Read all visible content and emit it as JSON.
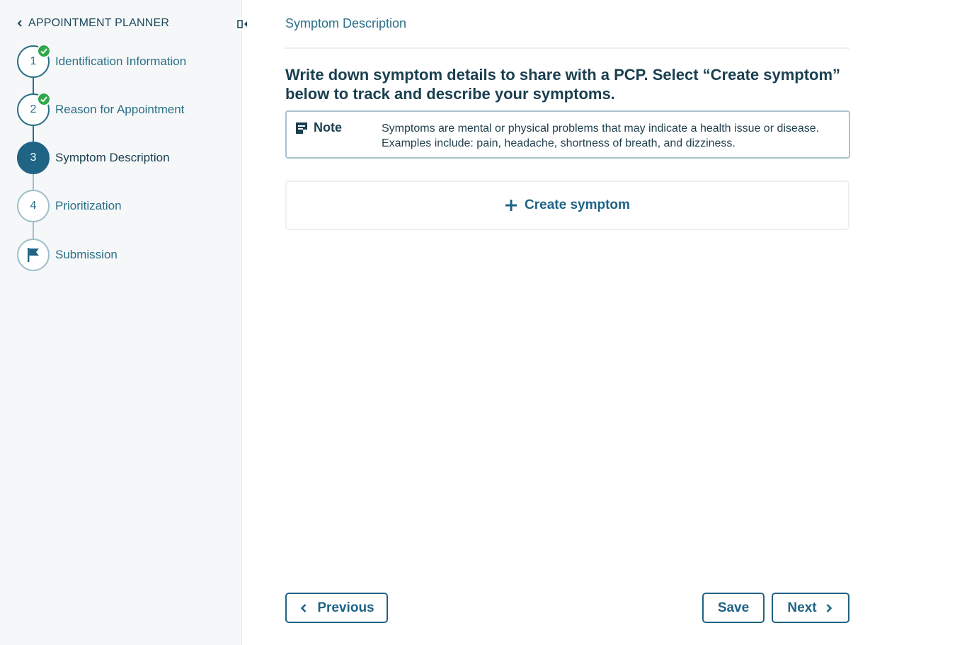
{
  "sidebar": {
    "title": "APPOINTMENT PLANNER",
    "steps": [
      {
        "number": "1",
        "label": "Identification Information",
        "status": "complete"
      },
      {
        "number": "2",
        "label": "Reason for Appointment",
        "status": "complete"
      },
      {
        "number": "3",
        "label": "Symptom Description",
        "status": "current"
      },
      {
        "number": "4",
        "label": "Prioritization",
        "status": "pending"
      },
      {
        "number": "",
        "label": "Submission",
        "status": "pending",
        "icon": "flag-icon"
      }
    ]
  },
  "main": {
    "page_title": "Symptom Description",
    "heading": "Write down symptom details to share with a PCP. Select “Create symptom” below to track and describe your symptoms.",
    "note": {
      "title": "Note",
      "body": "Symptoms are mental or physical problems that may indicate a health issue or disease. Examples include: pain, headache, shortness of breath, and dizziness."
    },
    "create_button": "Create symptom"
  },
  "footer": {
    "previous": "Previous",
    "save": "Save",
    "next": "Next"
  },
  "colors": {
    "accent": "#1f6485",
    "complete": "#2ea84a",
    "sidebar_bg": "#f5f7f8"
  }
}
